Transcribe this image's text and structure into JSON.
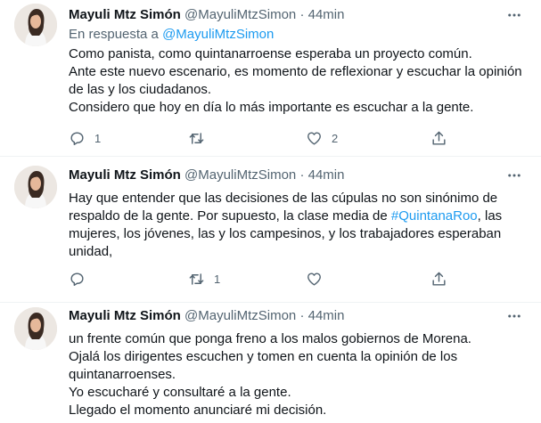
{
  "tweets": [
    {
      "name": "Mayuli Mtz Simón",
      "handle": "@MayuliMtzSimon",
      "dot": "·",
      "time": "44min",
      "reply_prefix": "En respuesta a",
      "reply_mention": "@MayuliMtzSimon",
      "lines": [
        "Como panista, como quintanarroense esperaba un proyecto común.",
        "Ante este nuevo escenario, es momento de reflexionar y escuchar la opinión",
        "de las y los ciudadanos.",
        "Considero que hoy en día lo más importante es escuchar a la gente."
      ],
      "reply_count": "1",
      "retweet_count": "",
      "like_count": "2"
    },
    {
      "name": "Mayuli Mtz Simón",
      "handle": "@MayuliMtzSimon",
      "dot": "·",
      "time": "44min",
      "lines": [
        "Hay que entender que las decisiones de las cúpulas no son sinónimo de",
        "respaldo de la gente. Por supuesto, la clase media de ",
        "mujeres, los jóvenes, las y los campesinos, y los trabajadores esperaban",
        "unidad,"
      ],
      "hashtag": "#QuintanaRoo",
      "line2_suffix": ", las",
      "reply_count": "",
      "retweet_count": "1",
      "like_count": ""
    },
    {
      "name": "Mayuli Mtz Simón",
      "handle": "@MayuliMtzSimon",
      "dot": "·",
      "time": "44min",
      "lines": [
        "un frente común que ponga freno a los malos gobiernos de Morena.",
        "Ojalá los dirigentes escuchen y tomen en cuenta la opinión de los",
        "quintanarroenses.",
        "Yo escucharé y consultaré a la gente.",
        "Llegado el momento anunciaré mi decisión."
      ]
    }
  ],
  "icons": {
    "reply": "reply-icon",
    "retweet": "retweet-icon",
    "like": "heart-icon",
    "share": "share-icon",
    "more": "more-icon"
  },
  "colors": {
    "link": "#1d9bf0",
    "muted": "#536471",
    "text": "#0f1419"
  }
}
